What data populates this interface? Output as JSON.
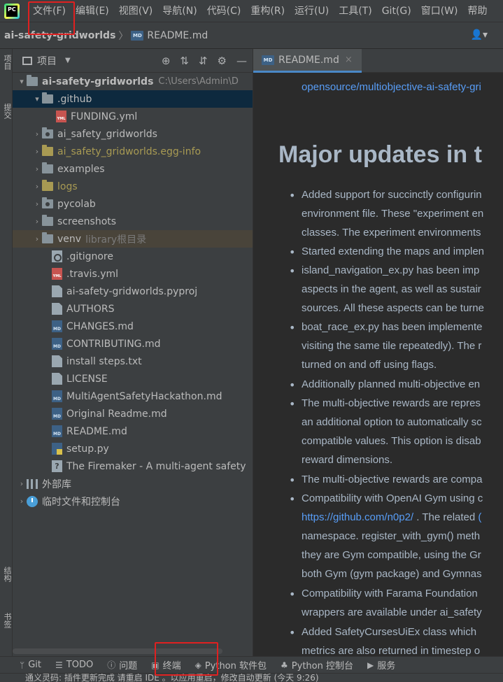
{
  "menu": {
    "items": [
      "文件(F)",
      "编辑(E)",
      "视图(V)",
      "导航(N)",
      "代码(C)",
      "重构(R)",
      "运行(U)",
      "工具(T)",
      "Git(G)",
      "窗口(W)",
      "帮助"
    ]
  },
  "navbar": {
    "project": "ai-safety-gridworlds",
    "file": "README.md",
    "md_badge": "MD"
  },
  "left_stripe": {
    "top_label": "项目",
    "mid_label": "提交",
    "structure_label": "结构",
    "bookmarks_label": "书签"
  },
  "project_panel": {
    "title": "项目",
    "tree": {
      "root_name": "ai-safety-gridworlds",
      "root_path": "C:\\Users\\Admin\\D",
      "github": ".github",
      "funding": "FUNDING.yml",
      "pkg": "ai_safety_gridworlds",
      "egg_info": "ai_safety_gridworlds.egg-info",
      "examples": "examples",
      "logs": "logs",
      "pycolab": "pycolab",
      "screenshots": "screenshots",
      "venv": "venv",
      "venv_hint": "library根目录",
      "gitignore": ".gitignore",
      "travis": ".travis.yml",
      "pyproj": "ai-safety-gridworlds.pyproj",
      "authors": "AUTHORS",
      "changes": "CHANGES.md",
      "contributing": "CONTRIBUTING.md",
      "install_steps": "install steps.txt",
      "license": "LICENSE",
      "hackathon": "MultiAgentSafetyHackathon.md",
      "original_readme": "Original Readme.md",
      "readme": "README.md",
      "setup": "setup.py",
      "firemaker": "The Firemaker - A multi-agent safety",
      "external_libs": "外部库",
      "scratches": "临时文件和控制台"
    },
    "file_badges": {
      "md": "MD",
      "yml": "YML"
    }
  },
  "editor": {
    "tab_label": "README.md",
    "tab_close": "×",
    "link_top": "opensource/multiobjective-ai-safety-gri",
    "heading": "Major updates in t",
    "lines": [
      "Added support for succinctly configurin",
      "environment file. These \"experiment en",
      "classes. The experiment environments",
      "Started extending the maps and implen",
      "island_navigation_ex.py has been imp",
      "aspects in the agent, as well as sustair",
      "sources. All these aspects can be turne",
      "boat_race_ex.py has been implemente",
      "visiting the same tile repeatedly). The r",
      "turned on and off using flags.",
      "Additionally planned multi-objective en",
      "The multi-objective rewards are repres",
      "an additional option to automatically sc",
      "compatible values. This option is disab",
      "reward dimensions.",
      "The multi-objective rewards are compa",
      "Compatibility with OpenAI Gym using c",
      " . The related ",
      "namespace. register_with_gym() meth",
      "they are Gym compatible, using the Gr",
      "both Gym (gym package) and Gymnas",
      "Compatibility with Farama Foundation",
      "wrappers are available under ai_safety",
      "Added SafetyCursesUiEx class which",
      "metrics are also returned in timestep o"
    ],
    "inline_link": "https://github.com/n0p2/",
    "trailing_char": "("
  },
  "bottom_bar": {
    "items": [
      "Git",
      "TODO",
      "问题",
      "终端",
      "Python 软件包",
      "Python 控制台",
      "服务"
    ]
  },
  "status_bar": {
    "text": "通义灵码: 插件更新完成   请重启 IDE 。以应用重启，修改自动更新 (今天 9:26)"
  },
  "colors": {
    "highlight": "#e02020",
    "link": "#589df6",
    "selection": "#0d293e"
  }
}
